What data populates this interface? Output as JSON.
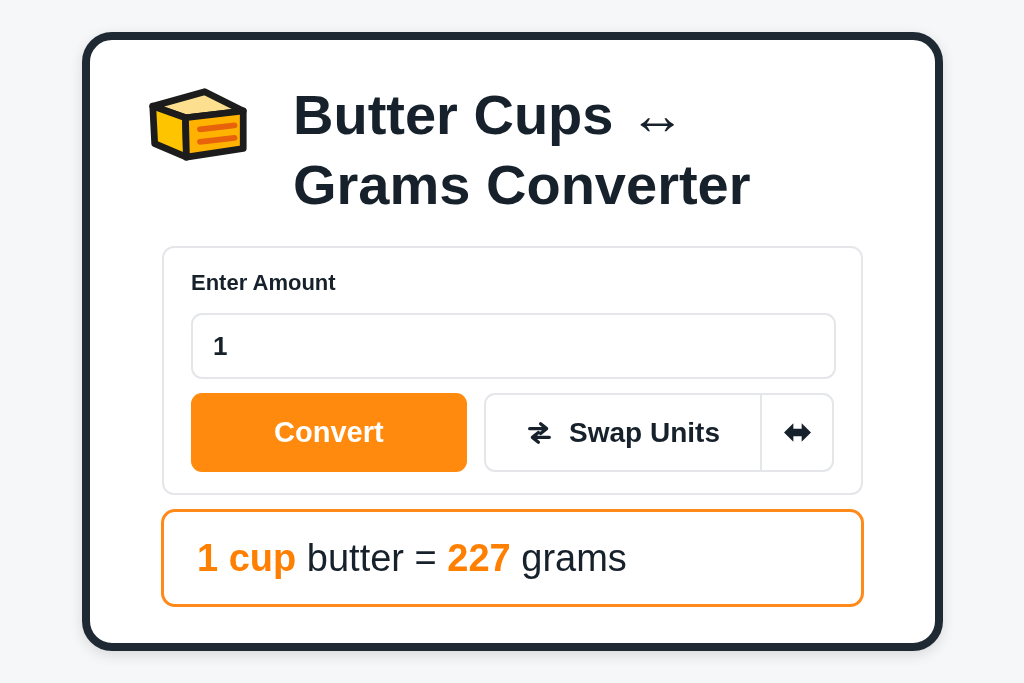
{
  "header": {
    "title": "Butter Cups ↔ Grams Converter"
  },
  "form": {
    "label": "Enter Amount",
    "amount_field": {
      "value": "1"
    },
    "convert_button": "Convert",
    "swap_button": "Swap Units"
  },
  "result": {
    "text": "**1 cup** butter = **227** grams"
  }
}
